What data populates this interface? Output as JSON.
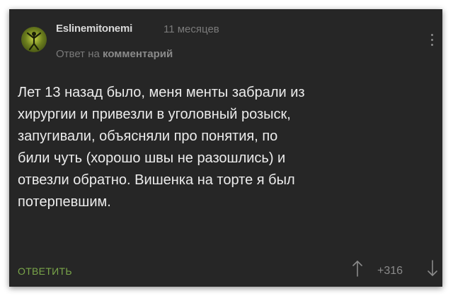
{
  "comment": {
    "author": "Eslinemitonemi",
    "time": "11 месяцев",
    "reply_prefix": "Ответ на",
    "reply_link": "комментарий",
    "lines": [
      "Лет 13 назад было, меня менты забрали из",
      "хирургии и привезли в уголовный розыск,",
      "запугивали, объясняли про понятия, по",
      "били чуть (хорошо швы не разошлись) и",
      "отвезли обратно. Вишенка на торте я был",
      "потерпевшим."
    ]
  },
  "actions": {
    "reply_label": "ОТВЕТИТЬ",
    "rating": "+316",
    "up_icon": "arrow-up-icon",
    "down_icon": "arrow-down-icon",
    "more_icon": "more-vertical-icon"
  },
  "colors": {
    "background": "#262626",
    "accent": "#7aa64a"
  }
}
